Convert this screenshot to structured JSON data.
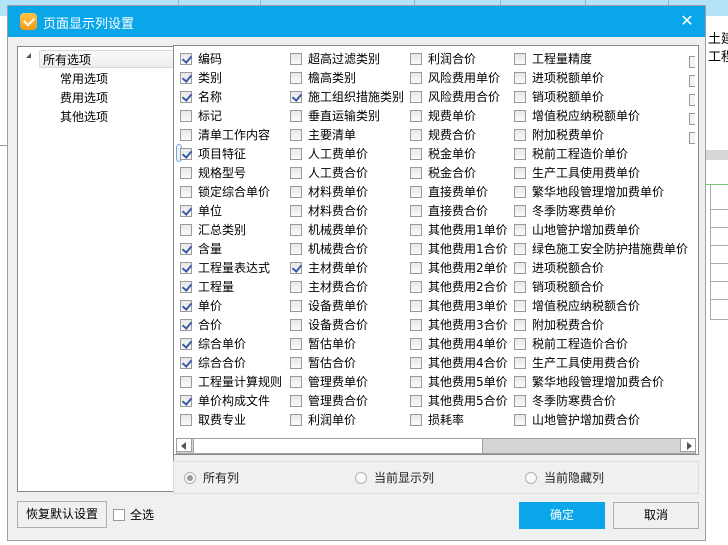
{
  "background": {
    "right_texts": [
      "土建工",
      "工程"
    ]
  },
  "dialog": {
    "title": "页面显示列设置",
    "close_icon": "close-icon",
    "accent_color": "#0aa6ea"
  },
  "tree": {
    "root": "所有选项",
    "children": [
      "常用选项",
      "费用选项",
      "其他选项"
    ]
  },
  "columns": [
    [
      {
        "label": "编码",
        "checked": true
      },
      {
        "label": "类别",
        "checked": true
      },
      {
        "label": "名称",
        "checked": true
      },
      {
        "label": "标记",
        "checked": false
      },
      {
        "label": "清单工作内容",
        "checked": false
      },
      {
        "label": "项目特征",
        "checked": true,
        "focused": true
      },
      {
        "label": "规格型号",
        "checked": false
      },
      {
        "label": "锁定综合单价",
        "checked": false
      },
      {
        "label": "单位",
        "checked": true
      },
      {
        "label": "汇总类别",
        "checked": false
      },
      {
        "label": "含量",
        "checked": true
      },
      {
        "label": "工程量表达式",
        "checked": true
      },
      {
        "label": "工程量",
        "checked": true
      },
      {
        "label": "单价",
        "checked": true
      },
      {
        "label": "合价",
        "checked": true
      },
      {
        "label": "综合单价",
        "checked": true
      },
      {
        "label": "综合合价",
        "checked": true
      },
      {
        "label": "工程量计算规则",
        "checked": false
      },
      {
        "label": "单价构成文件",
        "checked": true
      },
      {
        "label": "取费专业",
        "checked": false
      }
    ],
    [
      {
        "label": "超高过滤类别",
        "checked": false
      },
      {
        "label": "檐高类别",
        "checked": false
      },
      {
        "label": "施工组织措施类别",
        "checked": true
      },
      {
        "label": "垂直运输类别",
        "checked": false
      },
      {
        "label": "主要清单",
        "checked": false
      },
      {
        "label": "人工费单价",
        "checked": false
      },
      {
        "label": "人工费合价",
        "checked": false
      },
      {
        "label": "材料费单价",
        "checked": false
      },
      {
        "label": "材料费合价",
        "checked": false
      },
      {
        "label": "机械费单价",
        "checked": false
      },
      {
        "label": "机械费合价",
        "checked": false
      },
      {
        "label": "主材费单价",
        "checked": true
      },
      {
        "label": "主材费合价",
        "checked": false
      },
      {
        "label": "设备费单价",
        "checked": false
      },
      {
        "label": "设备费合价",
        "checked": false
      },
      {
        "label": "暂估单价",
        "checked": false
      },
      {
        "label": "暂估合价",
        "checked": false
      },
      {
        "label": "管理费单价",
        "checked": false
      },
      {
        "label": "管理费合价",
        "checked": false
      },
      {
        "label": "利润单价",
        "checked": false
      }
    ],
    [
      {
        "label": "利润合价",
        "checked": false
      },
      {
        "label": "风险费用单价",
        "checked": false
      },
      {
        "label": "风险费用合价",
        "checked": false
      },
      {
        "label": "规费单价",
        "checked": false
      },
      {
        "label": "规费合价",
        "checked": false
      },
      {
        "label": "税金单价",
        "checked": false
      },
      {
        "label": "税金合价",
        "checked": false
      },
      {
        "label": "直接费单价",
        "checked": false
      },
      {
        "label": "直接费合价",
        "checked": false
      },
      {
        "label": "其他费用1单价",
        "checked": false
      },
      {
        "label": "其他费用1合价",
        "checked": false
      },
      {
        "label": "其他费用2单价",
        "checked": false
      },
      {
        "label": "其他费用2合价",
        "checked": false
      },
      {
        "label": "其他费用3单价",
        "checked": false
      },
      {
        "label": "其他费用3合价",
        "checked": false
      },
      {
        "label": "其他费用4单价",
        "checked": false
      },
      {
        "label": "其他费用4合价",
        "checked": false
      },
      {
        "label": "其他费用5单价",
        "checked": false
      },
      {
        "label": "其他费用5合价",
        "checked": false
      },
      {
        "label": "损耗率",
        "checked": false
      }
    ],
    [
      {
        "label": "工程量精度",
        "checked": false
      },
      {
        "label": "进项税额单价",
        "checked": false
      },
      {
        "label": "销项税额单价",
        "checked": false
      },
      {
        "label": "增值税应纳税额单价",
        "checked": false
      },
      {
        "label": "附加税费单价",
        "checked": false
      },
      {
        "label": "税前工程造价单价",
        "checked": false
      },
      {
        "label": "生产工具使用费单价",
        "checked": false
      },
      {
        "label": "繁华地段管理增加费单价",
        "checked": false
      },
      {
        "label": "冬季防寒费单价",
        "checked": false
      },
      {
        "label": "山地管护增加费单价",
        "checked": false
      },
      {
        "label": "绿色施工安全防护措施费单价",
        "checked": false
      },
      {
        "label": "进项税额合价",
        "checked": false
      },
      {
        "label": "销项税额合价",
        "checked": false
      },
      {
        "label": "增值税应纳税额合价",
        "checked": false
      },
      {
        "label": "附加税费合价",
        "checked": false
      },
      {
        "label": "税前工程造价合价",
        "checked": false
      },
      {
        "label": "生产工具使用费合价",
        "checked": false
      },
      {
        "label": "繁华地段管理增加费合价",
        "checked": false
      },
      {
        "label": "冬季防寒费合价",
        "checked": false
      },
      {
        "label": "山地管护增加费合价",
        "checked": false
      }
    ]
  ],
  "horizontal_scroll": {
    "position_fraction": 0.0,
    "visible_fraction": 0.57
  },
  "filter": {
    "options": [
      {
        "label": "所有列",
        "selected": true
      },
      {
        "label": "当前显示列",
        "selected": false
      },
      {
        "label": "当前隐藏列",
        "selected": false
      }
    ]
  },
  "footer": {
    "restore_label": "恢复默认设置",
    "select_all_label": "全选",
    "select_all_checked": false,
    "ok_label": "确定",
    "cancel_label": "取消"
  }
}
